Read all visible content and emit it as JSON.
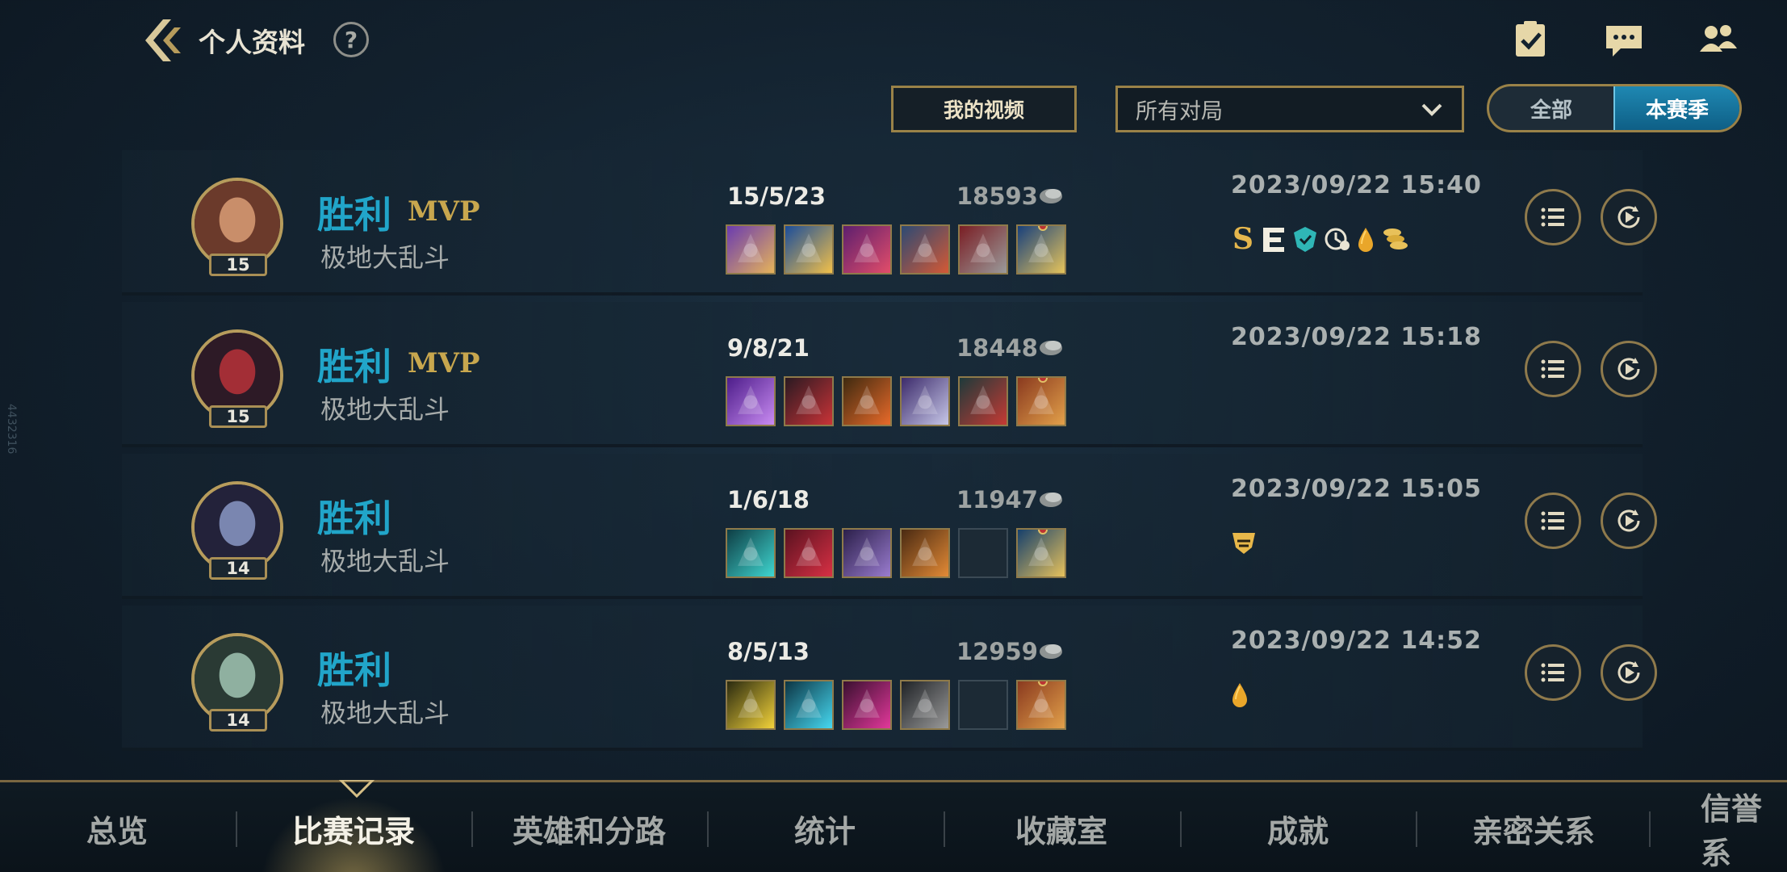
{
  "header": {
    "title": "个人资料",
    "help_label": "?"
  },
  "filters": {
    "videos_label": "我的视频",
    "match_type": "所有对局",
    "season_options": [
      "全部",
      "本赛季"
    ],
    "season_active": "本赛季"
  },
  "matches": [
    {
      "result": "胜利",
      "mvp": "MVP",
      "mode": "极地大乱斗",
      "level": "15",
      "kda": "15/5/23",
      "gold": "18593",
      "date": "2023/09/22 15:40",
      "badges": [
        "S",
        "penta-E",
        "shield",
        "clock",
        "drop",
        "coins"
      ],
      "champion_colors": [
        "#6b3a2b",
        "#c98e6a"
      ],
      "items": [
        {
          "icon": "purple-hat",
          "c1": "#6a3bb0",
          "c2": "#e6b35a"
        },
        {
          "icon": "blue-staff",
          "c1": "#1b4d9a",
          "c2": "#f1c04a"
        },
        {
          "icon": "dark-shoes",
          "c1": "#5d1f6e",
          "c2": "#e24d6a"
        },
        {
          "icon": "armor",
          "c1": "#2c4a74",
          "c2": "#d45935"
        },
        {
          "icon": "red-armor",
          "c1": "#7a1e24",
          "c2": "#9a9a9a"
        },
        {
          "icon": "trinket-lens",
          "c1": "#18407c",
          "c2": "#e6c45b",
          "trinket": true
        }
      ]
    },
    {
      "result": "胜利",
      "mvp": "MVP",
      "mode": "极地大乱斗",
      "level": "15",
      "kda": "9/8/21",
      "gold": "18448",
      "date": "2023/09/22 15:18",
      "badges": [],
      "champion_colors": [
        "#2d1a26",
        "#a32e36"
      ],
      "items": [
        {
          "icon": "purple-sword",
          "c1": "#4d1d8a",
          "c2": "#c98bf2"
        },
        {
          "icon": "dark-blade",
          "c1": "#2a1a22",
          "c2": "#c93337"
        },
        {
          "icon": "fire-blade",
          "c1": "#3f2a10",
          "c2": "#e86a2a"
        },
        {
          "icon": "spear",
          "c1": "#3c2b6b",
          "c2": "#c7c7e8"
        },
        {
          "icon": "red-shield",
          "c1": "#1e3a3a",
          "c2": "#c53a34"
        },
        {
          "icon": "poro-trinket",
          "c1": "#8a3a1f",
          "c2": "#e2a04a",
          "trinket": true
        }
      ]
    },
    {
      "result": "胜利",
      "mvp": "",
      "mode": "极地大乱斗",
      "level": "14",
      "kda": "1/6/18",
      "gold": "11947",
      "date": "2023/09/22 15:05",
      "badges": [
        "shield-small"
      ],
      "champion_colors": [
        "#23223a",
        "#7a86b0"
      ],
      "items": [
        {
          "icon": "teal-blade",
          "c1": "#0e3d44",
          "c2": "#3fd6d0"
        },
        {
          "icon": "crimson-blade",
          "c1": "#5a1220",
          "c2": "#d83044"
        },
        {
          "icon": "purple-cloak",
          "c1": "#2b1f4a",
          "c2": "#9a7ccf"
        },
        {
          "icon": "bow",
          "c1": "#4a2a12",
          "c2": "#e38a36"
        },
        {
          "icon": "empty",
          "c1": "",
          "c2": "",
          "empty": true
        },
        {
          "icon": "blue-totem",
          "c1": "#16406c",
          "c2": "#e7c25c",
          "trinket": true
        }
      ]
    },
    {
      "result": "胜利",
      "mvp": "",
      "mode": "极地大乱斗",
      "level": "14",
      "kda": "8/5/13",
      "gold": "12959",
      "date": "2023/09/22 14:52",
      "badges": [
        "drop"
      ],
      "champion_colors": [
        "#2a3a34",
        "#8fb0a0"
      ],
      "items": [
        {
          "icon": "yellow-triangle",
          "c1": "#2a2a10",
          "c2": "#f2d23a"
        },
        {
          "icon": "cyan-claw",
          "c1": "#0c3544",
          "c2": "#46d8f0"
        },
        {
          "icon": "magenta-dagger",
          "c1": "#3a1030",
          "c2": "#e2389a"
        },
        {
          "icon": "gauntlet",
          "c1": "#1f2226",
          "c2": "#9a9a9a"
        },
        {
          "icon": "empty",
          "c1": "",
          "c2": "",
          "empty": true
        },
        {
          "icon": "poro-trinket",
          "c1": "#8a3a1f",
          "c2": "#e2a04a",
          "trinket": true
        }
      ]
    }
  ],
  "nav": {
    "tabs": [
      "总览",
      "比赛记录",
      "英雄和分路",
      "统计",
      "收藏室",
      "成就",
      "亲密关系",
      "信誉系"
    ],
    "active": "比赛记录"
  },
  "watermark": "4432316",
  "colors": {
    "accent_gold": "#9a8248",
    "victory_blue": "#21a5c9",
    "mvp_gold": "#c8a74e"
  }
}
